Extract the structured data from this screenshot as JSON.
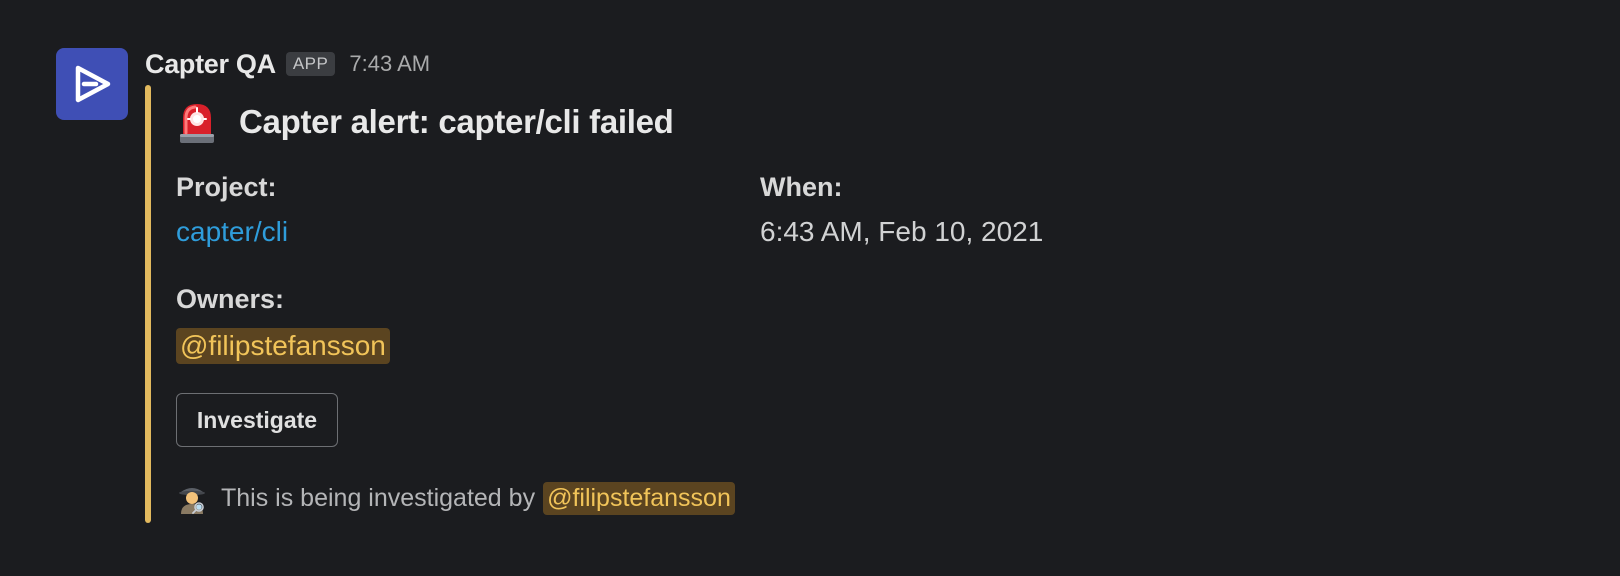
{
  "message": {
    "sender": "Capter QA",
    "app_badge": "APP",
    "timestamp": "7:43 AM",
    "avatar_color": "#3f4fb5"
  },
  "attachment": {
    "accent_color": "#e2b95e",
    "title_icon": "rotating-light-icon",
    "title": "Capter alert: capter/cli failed",
    "fields": {
      "project": {
        "label": "Project:",
        "value": "capter/cli"
      },
      "when": {
        "label": "When:",
        "value": "6:43 AM, Feb 10, 2021"
      },
      "owners": {
        "label": "Owners:",
        "value": "@filipstefansson"
      }
    },
    "button": {
      "label": "Investigate"
    },
    "context": {
      "icon": "detective-icon",
      "text": "This is being investigated by",
      "mention": "@filipstefansson"
    }
  }
}
